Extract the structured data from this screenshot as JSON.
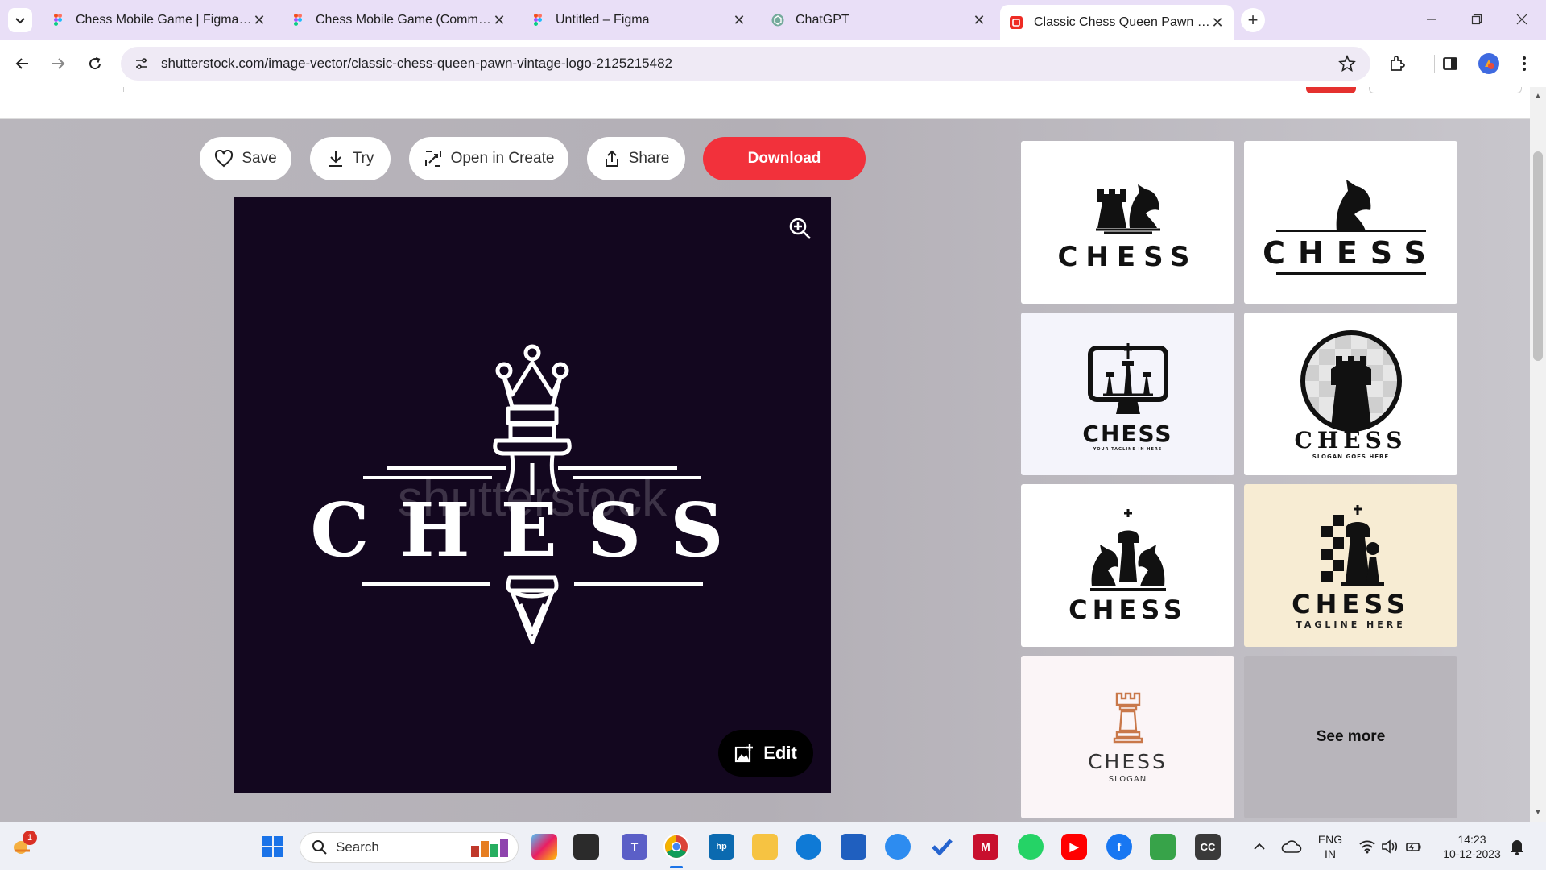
{
  "browser": {
    "tabs": [
      {
        "label": "Chess Mobile Game | Figma Co",
        "favicon": "figma-icon"
      },
      {
        "label": "Chess Mobile Game (Communi",
        "favicon": "figma-icon"
      },
      {
        "label": "Untitled – Figma",
        "favicon": "figma-icon"
      },
      {
        "label": "ChatGPT",
        "favicon": "chatgpt-icon"
      },
      {
        "label": "Classic Chess Queen Pawn Vint",
        "favicon": "shutterstock-icon",
        "active": true
      }
    ],
    "url": "shutterstock.com/image-vector/classic-chess-queen-pawn-vintage-logo-2125215482"
  },
  "actions": {
    "save": "Save",
    "try": "Try",
    "open_in_create": "Open in Create",
    "share": "Share",
    "download": "Download"
  },
  "preview": {
    "title_text": "CHESS",
    "watermark": "shutterstock",
    "edit": "Edit"
  },
  "related": [
    {
      "text": "CHESS",
      "tagline": ""
    },
    {
      "text": "CHESS",
      "tagline": ""
    },
    {
      "text": "CHESS",
      "tagline": "YOUR TAGLINE IN HERE"
    },
    {
      "text": "CHESS",
      "tagline": "SLOGAN GOES HERE"
    },
    {
      "text": "CHESS",
      "tagline": ""
    },
    {
      "text": "CHESS",
      "tagline": "TAGLINE HERE"
    },
    {
      "text": "CHESS",
      "tagline": "SLOGAN"
    }
  ],
  "see_more": "See more",
  "taskbar": {
    "search": "Search",
    "badge": "1",
    "lang_1": "ENG",
    "lang_2": "IN",
    "time": "14:23",
    "date": "10-12-2023"
  },
  "colors": {
    "accent": "#f2313b",
    "preview_bg": "#13071f",
    "tab_strip": "#e9dff7"
  }
}
